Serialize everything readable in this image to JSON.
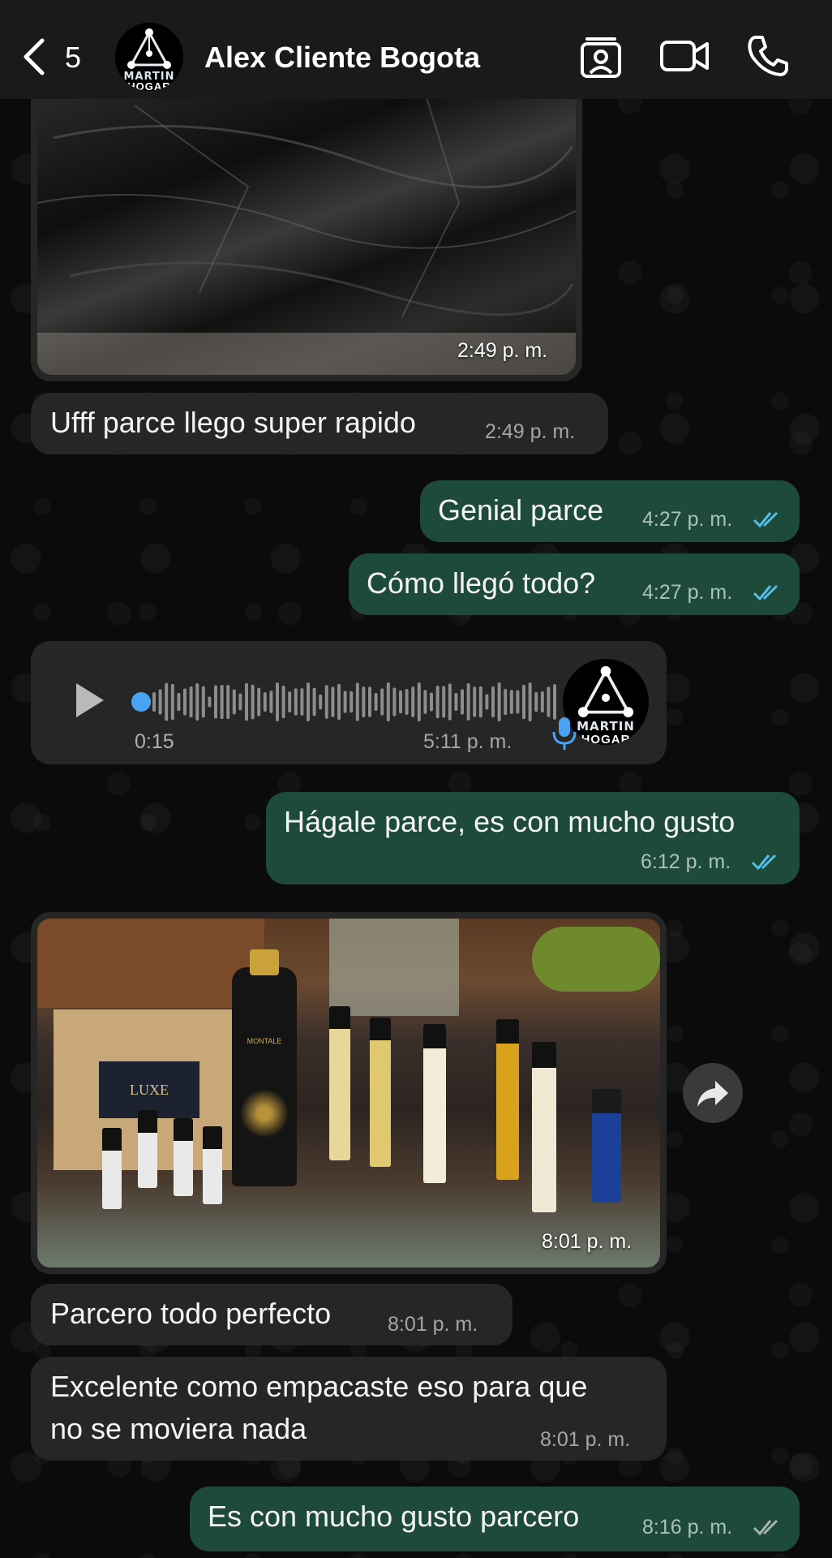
{
  "header": {
    "back_count": "5",
    "contact_name": "Alex Cliente Bogota",
    "avatar_text_top": "MARTIN",
    "avatar_text_bottom": "HOGAR"
  },
  "messages": [
    {
      "id": "m1",
      "type": "image",
      "direction": "in",
      "time": "2:49 p. m."
    },
    {
      "id": "m2",
      "type": "text",
      "direction": "in",
      "text": "Ufff parce llego super rapido",
      "time": "2:49 p. m."
    },
    {
      "id": "m3",
      "type": "text",
      "direction": "out",
      "text": "Genial parce",
      "time": "4:27 p. m.",
      "status": "read"
    },
    {
      "id": "m4",
      "type": "text",
      "direction": "out",
      "text": "Cómo llegó todo?",
      "time": "4:27 p. m.",
      "status": "read"
    },
    {
      "id": "m5",
      "type": "voice",
      "direction": "in",
      "duration": "0:15",
      "time": "5:11 p. m.",
      "progress": 0
    },
    {
      "id": "m6",
      "type": "text",
      "direction": "out",
      "text": "Hágale parce, es con mucho gusto",
      "time": "6:12 p. m.",
      "status": "read"
    },
    {
      "id": "m7",
      "type": "image",
      "direction": "in",
      "time": "8:01 p. m.",
      "labels": [
        "LUXE",
        "MONTALE"
      ]
    },
    {
      "id": "m8",
      "type": "text",
      "direction": "in",
      "text": "Parcero todo perfecto",
      "time": "8:01 p. m."
    },
    {
      "id": "m9",
      "type": "text",
      "direction": "in",
      "text_line1": "Excelente como empacaste eso para que",
      "text_line2": "no se moviera nada",
      "time": "8:01 p. m."
    },
    {
      "id": "m10",
      "type": "text",
      "direction": "out",
      "text": "Es con mucho gusto parcero",
      "time": "8:16 p. m.",
      "status": "delivered"
    }
  ],
  "colors": {
    "incoming_bubble": "#262626",
    "outgoing_bubble": "#1e4a3a",
    "read_ticks": "#53bdeb",
    "delivered_ticks": "#a9b3ad",
    "voice_accent": "#4aa3f0"
  },
  "icons": [
    "back-chevron-icon",
    "contact-card-icon",
    "video-camera-icon",
    "phone-icon",
    "play-icon",
    "microphone-icon",
    "forward-icon"
  ]
}
